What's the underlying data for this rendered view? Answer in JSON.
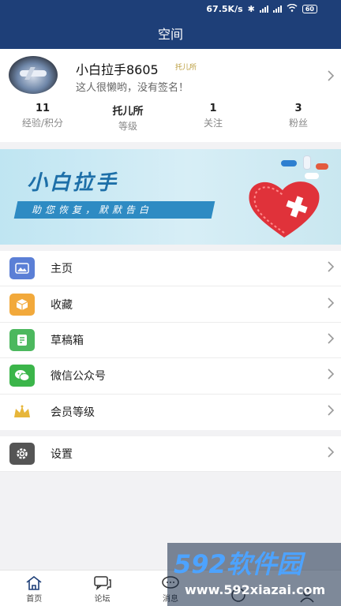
{
  "status_bar": {
    "speed": "67.5K/s",
    "battery": "60"
  },
  "header": {
    "title": "空间"
  },
  "profile": {
    "name": "小白拉手8605",
    "level_tag": "托儿所",
    "signature": "这人很懒哟，没有签名！"
  },
  "stats": [
    {
      "value": "11",
      "label": "经验/积分"
    },
    {
      "value": "托儿所",
      "label": "等级"
    },
    {
      "value": "1",
      "label": "关注"
    },
    {
      "value": "3",
      "label": "粉丝"
    }
  ],
  "banner": {
    "title": "小白拉手",
    "slogan": "助您恢复，默默告白"
  },
  "menu": [
    {
      "label": "主页",
      "icon": "image-icon",
      "color": "#5b7fd6"
    },
    {
      "label": "收藏",
      "icon": "box-icon",
      "color": "#f2a93b"
    },
    {
      "label": "草稿箱",
      "icon": "draft-icon",
      "color": "#4cb85e"
    },
    {
      "label": "微信公众号",
      "icon": "wechat-icon",
      "color": "#3bb54a"
    },
    {
      "label": "会员等级",
      "icon": "crown-icon",
      "color": "#e7b63a"
    }
  ],
  "settings": {
    "label": "设置",
    "icon": "gear-icon",
    "color": "#555555"
  },
  "bottom_nav": [
    {
      "label": "首页",
      "icon": "home-icon"
    },
    {
      "label": "论坛",
      "icon": "forum-icon"
    },
    {
      "label": "消息",
      "icon": "message-icon"
    },
    {
      "label": "",
      "icon": "discover-icon"
    },
    {
      "label": "",
      "icon": "profile-icon"
    }
  ],
  "watermark": {
    "brand": "592软件园",
    "url": "www.592xiazai.com"
  },
  "colors": {
    "header_bg": "#1e3f78",
    "accent": "#1d6fa8"
  }
}
